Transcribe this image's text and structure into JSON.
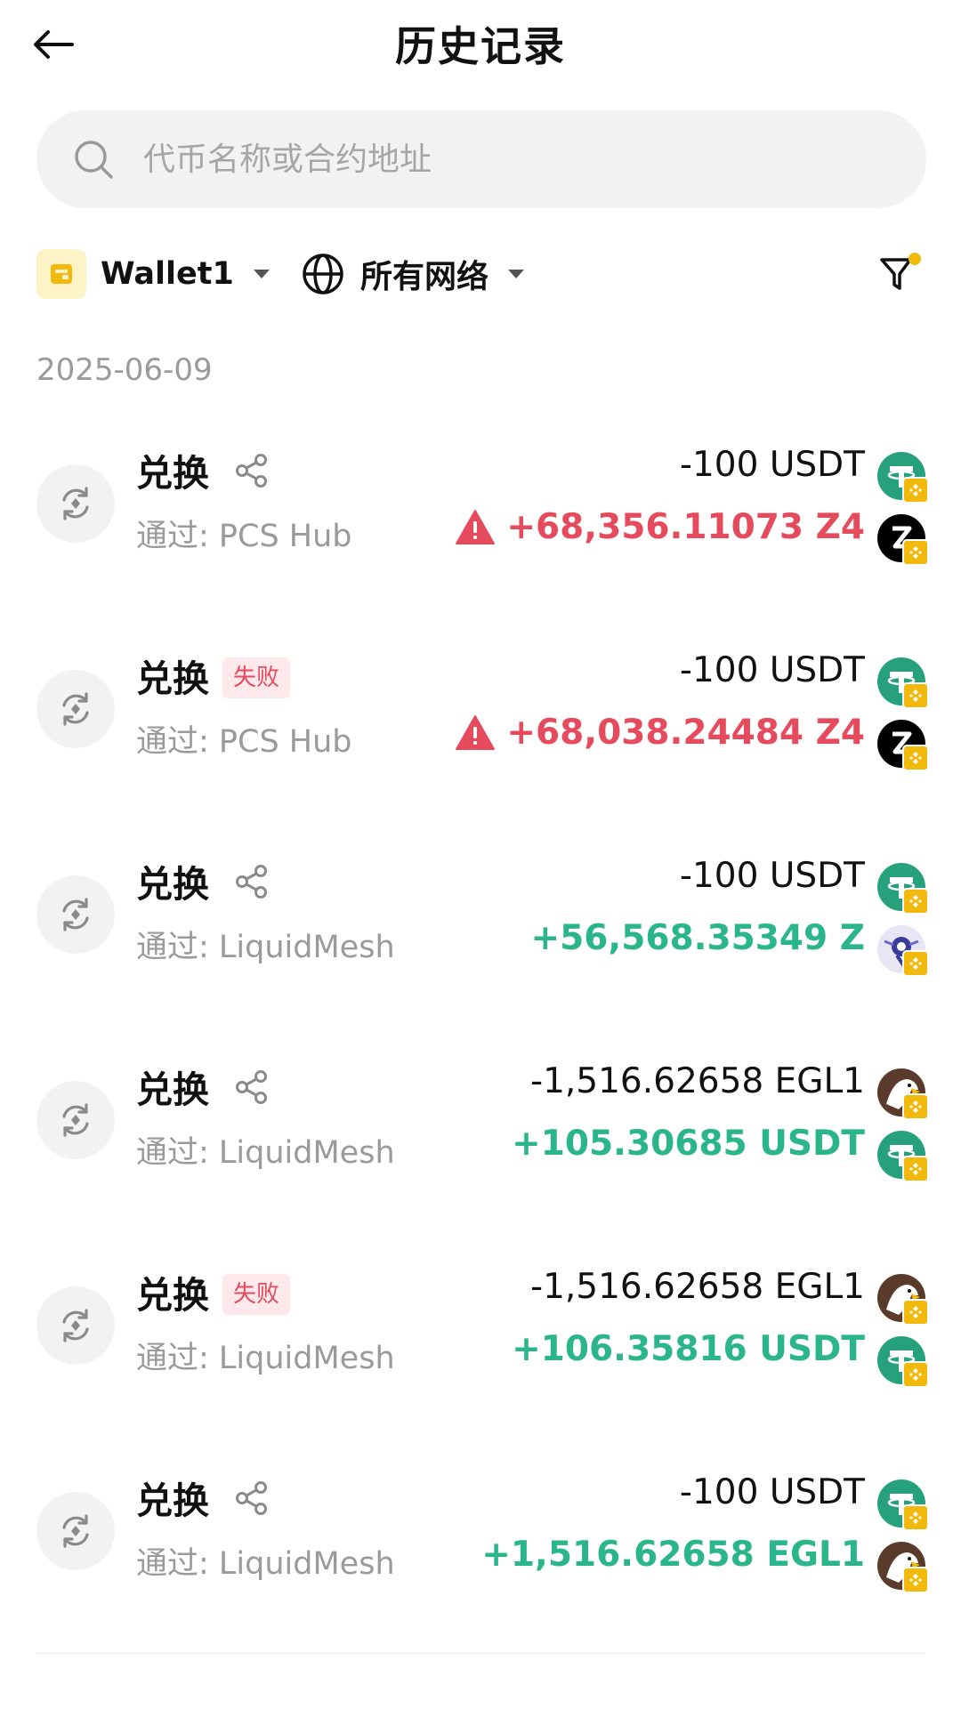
{
  "header": {
    "title": "历史记录"
  },
  "search": {
    "placeholder": "代币名称或合约地址"
  },
  "filters": {
    "wallet_label": "Wallet1",
    "network_label": "所有网络"
  },
  "date": "2025-06-09",
  "colors": {
    "positive": "#2bb58a",
    "negative_warning": "#e64b5d",
    "failed_badge_bg": "#fde8eb",
    "bnb_chain": "#f0b90b",
    "usdt": "#26a17b"
  },
  "transactions": [
    {
      "title": "兑换",
      "status": "",
      "via": "通过: PCS Hub",
      "amount_out": "-100 USDT",
      "amount_out_token": "usdt-icon",
      "amount_in": "+68,356.11073 Z4",
      "amount_in_token": "z4-icon",
      "amount_in_color": "red",
      "warning": true
    },
    {
      "title": "兑换",
      "status": "失败",
      "via": "通过: PCS Hub",
      "amount_out": "-100 USDT",
      "amount_out_token": "usdt-icon",
      "amount_in": "+68,038.24484 Z4",
      "amount_in_token": "z4-icon",
      "amount_in_color": "red",
      "warning": true
    },
    {
      "title": "兑换",
      "status": "",
      "via": "通过: LiquidMesh",
      "amount_out": "-100 USDT",
      "amount_out_token": "usdt-icon",
      "amount_in": "+56,568.35349 Z",
      "amount_in_token": "z-icon",
      "amount_in_color": "green",
      "warning": false
    },
    {
      "title": "兑换",
      "status": "",
      "via": "通过: LiquidMesh",
      "amount_out": "-1,516.62658 EGL1",
      "amount_out_token": "egl1-icon",
      "amount_in": "+105.30685 USDT",
      "amount_in_token": "usdt-icon",
      "amount_in_color": "green",
      "warning": false
    },
    {
      "title": "兑换",
      "status": "失败",
      "via": "通过: LiquidMesh",
      "amount_out": "-1,516.62658 EGL1",
      "amount_out_token": "egl1-icon",
      "amount_in": "+106.35816 USDT",
      "amount_in_token": "usdt-icon",
      "amount_in_color": "green",
      "warning": false
    },
    {
      "title": "兑换",
      "status": "",
      "via": "通过: LiquidMesh",
      "amount_out": "-100 USDT",
      "amount_out_token": "usdt-icon",
      "amount_in": "+1,516.62658 EGL1",
      "amount_in_token": "egl1-icon",
      "amount_in_color": "green",
      "warning": false
    }
  ]
}
